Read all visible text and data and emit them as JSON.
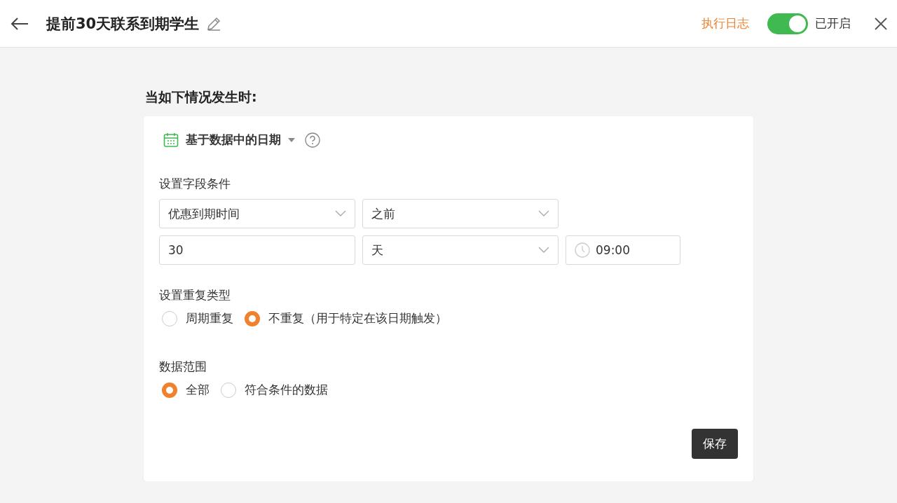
{
  "header": {
    "title": "提前30天联系到期学生",
    "log_link": "执行日志",
    "switch": {
      "on": true,
      "label": "已开启"
    }
  },
  "heading": "当如下情况发生时:",
  "card": {
    "trigger_type": "基于数据中的日期",
    "condition_label": "设置字段条件",
    "condition_rows": [
      [
        {
          "kind": "select",
          "value": "优惠到期时间"
        },
        {
          "kind": "select",
          "value": "之前"
        }
      ],
      [
        {
          "kind": "input",
          "value": "30"
        },
        {
          "kind": "select",
          "value": "天"
        },
        {
          "kind": "time",
          "value": "09:00"
        }
      ]
    ],
    "groups": [
      {
        "label": "设置重复类型",
        "options": [
          {
            "label": "周期重复",
            "selected": false
          },
          {
            "label": "不重复（用于特定在该日期触发）",
            "selected": true
          }
        ]
      },
      {
        "label": "数据范围",
        "options": [
          {
            "label": "全部",
            "selected": true
          },
          {
            "label": "符合条件的数据",
            "selected": false
          }
        ]
      }
    ],
    "save": "保存"
  }
}
